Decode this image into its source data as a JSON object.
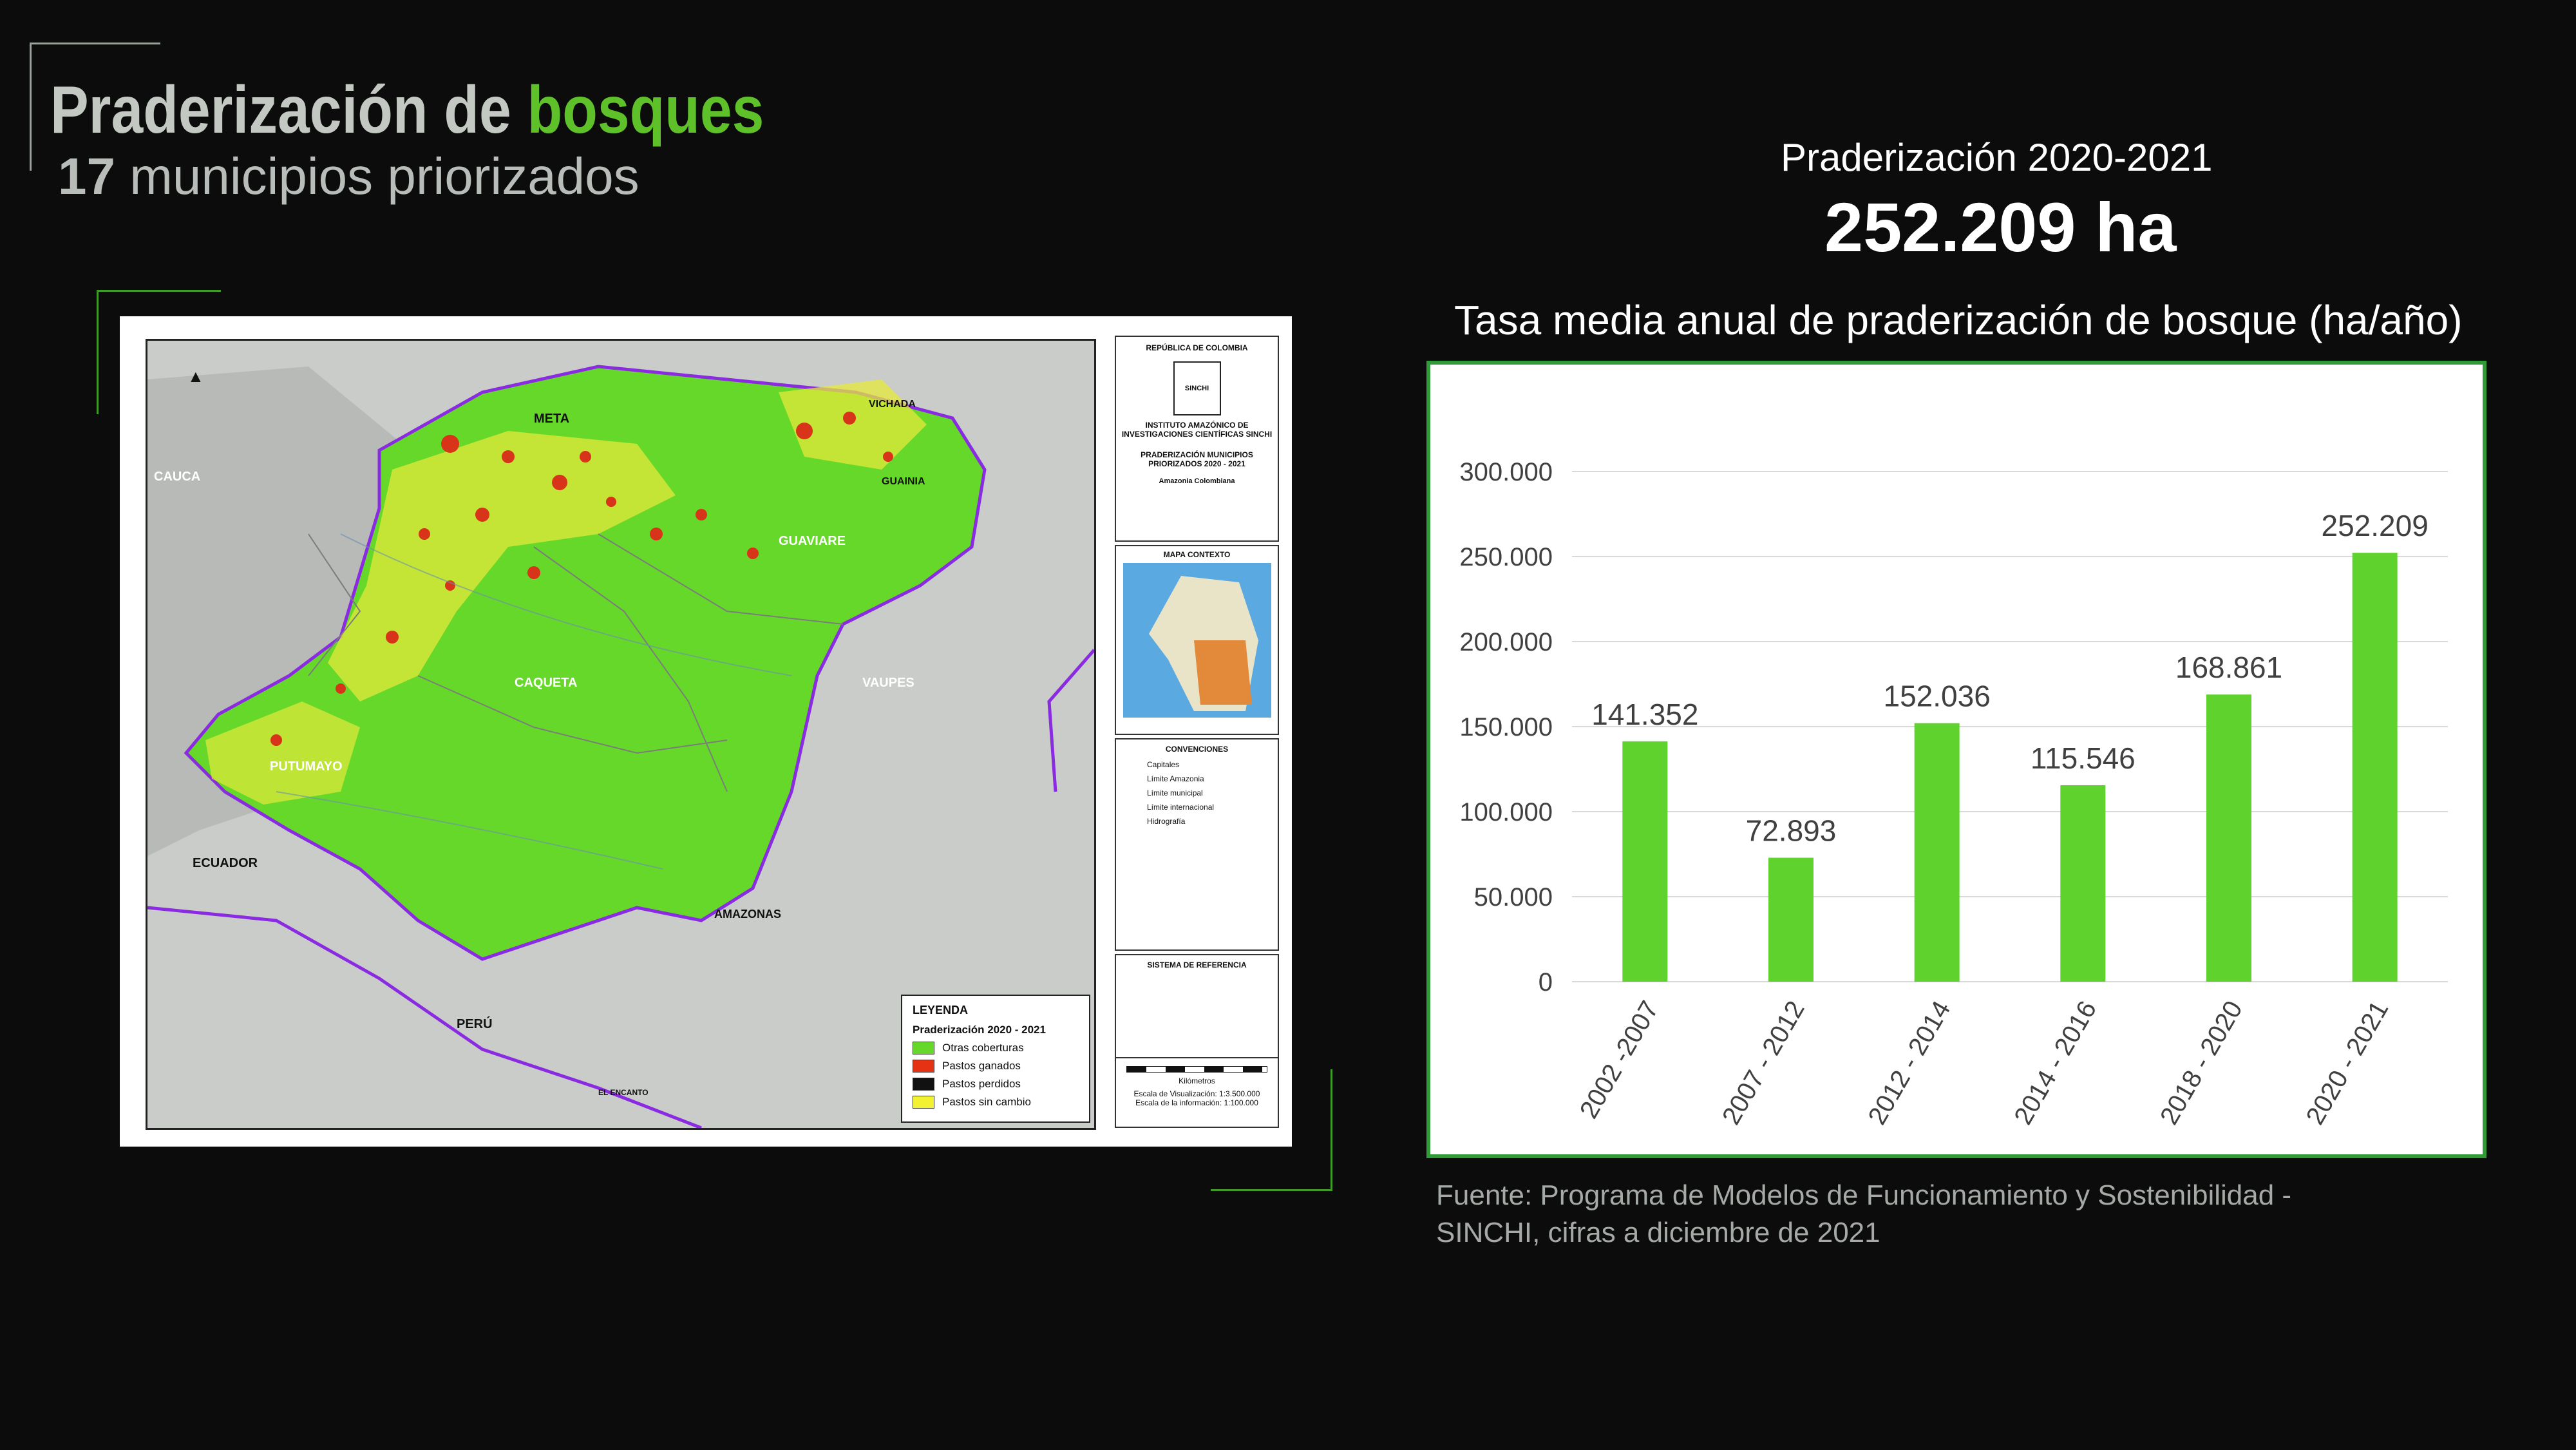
{
  "header": {
    "title_part1": "Praderización de",
    "title_accent": "bosques",
    "subtitle_number": "17",
    "subtitle_text": "municipios priorizados"
  },
  "kpi": {
    "label": "Praderización 2020-2021",
    "value": "252.209 ha"
  },
  "map": {
    "sidebar": {
      "country": "REPÚBLICA DE COLOMBIA",
      "institute": "INSTITUTO AMAZÓNICO DE INVESTIGACIONES CIENTÍFICAS SINCHI",
      "map_title": "PRADERIZACIÓN MUNICIPIOS PRIORIZADOS 2020 - 2021",
      "region": "Amazonia Colombiana",
      "context_title": "MAPA CONTEXTO",
      "conventions_title": "CONVENCIONES",
      "conventions": [
        "Capitales",
        "Límite Amazonia",
        "Límite municipal",
        "Límite internacional",
        "Hidrografía"
      ],
      "reference_title": "SISTEMA DE REFERENCIA",
      "scale_unit": "Kilómetros",
      "scale_view": "Escala de Visualización: 1:3.500.000",
      "scale_info": "Escala de la información: 1:100.000"
    },
    "legend": {
      "title": "LEYENDA",
      "subtitle": "Praderización 2020 - 2021",
      "items": [
        {
          "label": "Otras coberturas",
          "color": "#66d829"
        },
        {
          "label": "Pastos ganados",
          "color": "#e53215"
        },
        {
          "label": "Pastos perdidos",
          "color": "#111111"
        },
        {
          "label": "Pastos sin cambio",
          "color": "#f2f233"
        }
      ]
    },
    "labels": [
      "META",
      "VICHADA",
      "GUAINIA",
      "GUAVIARE",
      "CAUCA",
      "CAQUETA",
      "VAUPES",
      "PUTUMAYO",
      "ECUADOR",
      "AMAZONAS",
      "PERÚ",
      "EL ENCANTO"
    ]
  },
  "chart_data": {
    "type": "bar",
    "title": "Tasa media anual de praderización de bosque (ha/año)",
    "categories": [
      "2002 -2007",
      "2007 - 2012",
      "2012 - 2014",
      "2014 - 2016",
      "2018 - 2020",
      "2020 - 2021"
    ],
    "values": [
      141352,
      72893,
      152036,
      115546,
      168861,
      252209
    ],
    "value_labels": [
      "141.352",
      "72.893",
      "152.036",
      "115.546",
      "168.861",
      "252.209"
    ],
    "yticks": [
      0,
      50000,
      100000,
      150000,
      200000,
      250000,
      300000
    ],
    "ytick_labels": [
      "0",
      "50.000",
      "100.000",
      "150.000",
      "200.000",
      "250.000",
      "300.000"
    ],
    "ylim": [
      0,
      300000
    ],
    "bar_color": "#5fd22e",
    "grid": true
  },
  "source": {
    "text": "Fuente: Programa de Modelos de Funcionamiento y Sostenibilidad - SINCHI,  cifras a diciembre de 2021"
  }
}
